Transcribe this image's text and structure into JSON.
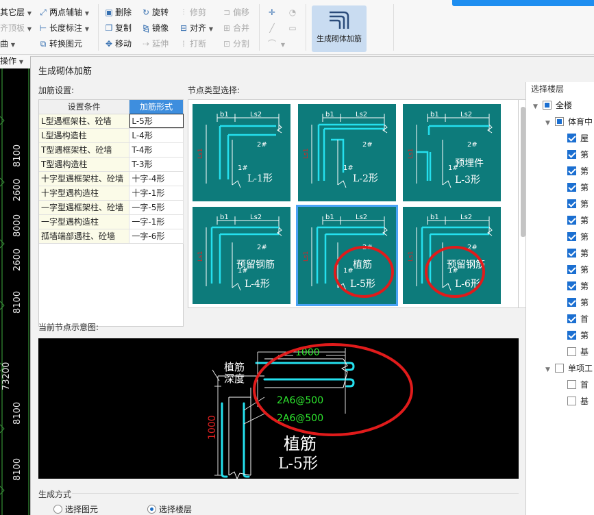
{
  "toolbar": {
    "col1": [
      "其它层",
      "齐顶板",
      "曲",
      "操作"
    ],
    "col2": [
      "两点辅轴",
      "长度标注",
      "转换图元"
    ],
    "col3": [
      "删除",
      "复制",
      "移动"
    ],
    "col4": [
      "旋转",
      "镜像",
      "延伸"
    ],
    "col5": [
      "修剪",
      "对齐",
      "打断"
    ],
    "col6": [
      "偏移",
      "合并",
      "分割"
    ],
    "gen_button": "生成砌体加筋"
  },
  "cad": {
    "dims": [
      "8100",
      "2600",
      "8000",
      "2600",
      "8100",
      "73200",
      "8100",
      "8100"
    ]
  },
  "dialog": {
    "title": "生成砌体加筋",
    "settings_label": "加筋设置:",
    "node_type_label": "节点类型选择:",
    "preview_label": "当前节点示意图:",
    "floor_label": "选择楼层",
    "table": {
      "headers": [
        "设置条件",
        "加筋形式"
      ],
      "rows": [
        [
          "L型遇框架柱、砼墙",
          "L-5形"
        ],
        [
          "L型遇构造柱",
          "L-4形"
        ],
        [
          "T型遇框架柱、砼墙",
          "T-4形"
        ],
        [
          "T型遇构造柱",
          "T-3形"
        ],
        [
          "十字型遇框架柱、砼墙",
          "十字-4形"
        ],
        [
          "十字型遇构造柱",
          "十字-1形"
        ],
        [
          "一字型遇框架柱、砼墙",
          "一字-5形"
        ],
        [
          "一字型遇构造柱",
          "一字-1形"
        ],
        [
          "孤墙端部遇柱、砼墙",
          "一字-6形"
        ]
      ]
    },
    "thumbnails": [
      {
        "label": "L-1形",
        "extra": ""
      },
      {
        "label": "L-2形",
        "extra": ""
      },
      {
        "label": "L-3形",
        "extra": "预埋件"
      },
      {
        "label": "L-4形",
        "extra": "预留钢筋"
      },
      {
        "label": "L-5形",
        "extra": "植筋"
      },
      {
        "label": "L-6形",
        "extra": "预留钢筋"
      }
    ],
    "preview": {
      "top_dim": "1000",
      "depth_label_1": "植筋",
      "depth_label_2": "深度",
      "rebar_1": "2A6@500",
      "rebar_2": "2A6@500",
      "side_dim": "1000",
      "caption_1": "植筋",
      "caption_2": "L-5形"
    },
    "gen_mode": {
      "label": "生成方式",
      "option_1": "选择图元",
      "option_2": "选择楼层"
    },
    "floors": [
      {
        "label": "全楼",
        "level": 0,
        "check": "partial",
        "arrow": true
      },
      {
        "label": "体育中",
        "level": 1,
        "check": "partial",
        "arrow": true
      },
      {
        "label": "屋",
        "level": 2,
        "check": "on"
      },
      {
        "label": "第",
        "level": 2,
        "check": "on"
      },
      {
        "label": "第",
        "level": 2,
        "check": "on"
      },
      {
        "label": "第",
        "level": 2,
        "check": "on"
      },
      {
        "label": "第",
        "level": 2,
        "check": "on"
      },
      {
        "label": "第",
        "level": 2,
        "check": "on"
      },
      {
        "label": "第",
        "level": 2,
        "check": "on"
      },
      {
        "label": "第",
        "level": 2,
        "check": "on"
      },
      {
        "label": "第",
        "level": 2,
        "check": "on"
      },
      {
        "label": "第",
        "level": 2,
        "check": "on"
      },
      {
        "label": "第",
        "level": 2,
        "check": "on"
      },
      {
        "label": "首",
        "level": 2,
        "check": "on"
      },
      {
        "label": "第",
        "level": 2,
        "check": "on"
      },
      {
        "label": "基",
        "level": 2,
        "check": "off"
      },
      {
        "label": "单项工",
        "level": 1,
        "check": "off",
        "arrow": true
      },
      {
        "label": "首",
        "level": 2,
        "check": "off"
      },
      {
        "label": "基",
        "level": 2,
        "check": "off"
      }
    ]
  },
  "colors": {
    "teal": "#0d7b7b",
    "cyan": "#25e0ee",
    "accent": "#3e8ede",
    "circle": "#e01b1b",
    "green_text": "#2ee82e"
  }
}
